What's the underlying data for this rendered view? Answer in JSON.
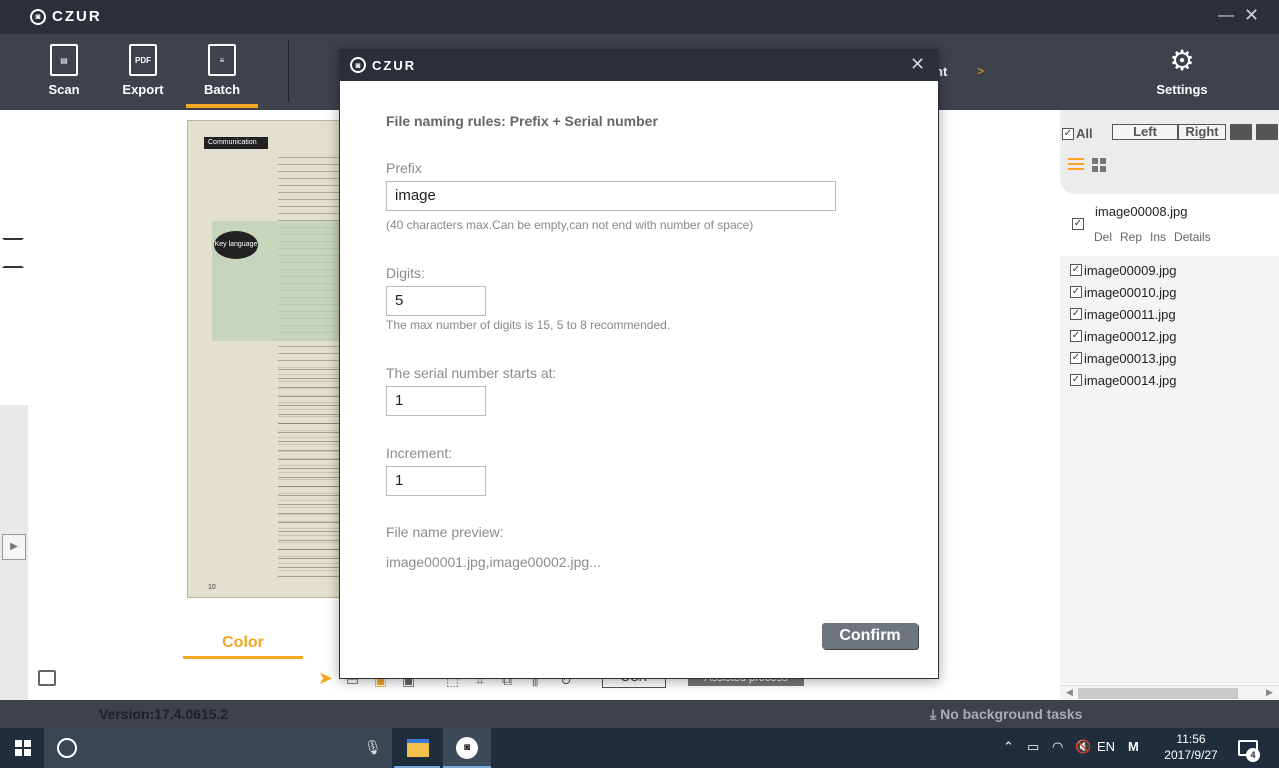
{
  "app": {
    "brand": "CZUR",
    "logo_icon": "czur-logo-icon"
  },
  "toolbar": {
    "scan_label": "Scan",
    "export_label": "Export",
    "export_icon_text": "PDF",
    "batch_label": "Batch",
    "settings_label": "Settings",
    "hidden_label_partial": "nt",
    "arrow": ">"
  },
  "preview": {
    "color_tab": "Color",
    "doc_header": "Communication",
    "doc_bubble": "Key language",
    "doc_pagenum": "10",
    "ocr_label": "OCR",
    "assisted_label": "Assisted process"
  },
  "right_panel": {
    "all_label": "All",
    "left_label": "Left",
    "right_label": "Right",
    "selected_file": "image00008.jpg",
    "actions": [
      "Del",
      "Rep",
      "Ins",
      "Details"
    ],
    "files": [
      "image00009.jpg",
      "image00010.jpg",
      "image00011.jpg",
      "image00012.jpg",
      "image00013.jpg",
      "image00014.jpg"
    ]
  },
  "status": {
    "version": "Version:17.4.0615.2",
    "background_tasks": "No background tasks"
  },
  "taskbar": {
    "lang": "EN",
    "ime": "M",
    "time": "11:56",
    "date": "2017/9/27",
    "notifications": "4"
  },
  "dialog": {
    "brand": "CZUR",
    "rule_title": "File naming rules: Prefix + Serial number",
    "prefix_label": "Prefix",
    "prefix_value": "image",
    "prefix_hint": "(40 characters max.Can be empty,can not end with number of space)",
    "digits_label": "Digits:",
    "digits_value": "5",
    "digits_hint": "The max number of digits is 15, 5 to 8 recommended.",
    "start_label": "The serial number starts at:",
    "start_value": "1",
    "increment_label": "Increment:",
    "increment_value": "1",
    "preview_label": "File name preview:",
    "preview_value": "image00001.jpg,image00002.jpg...",
    "confirm_label": "Confirm"
  },
  "colors": {
    "accent": "#f5a623",
    "titlebar": "#2b2f37",
    "toolbar": "#3d424b",
    "confirm": "#6f757d"
  }
}
